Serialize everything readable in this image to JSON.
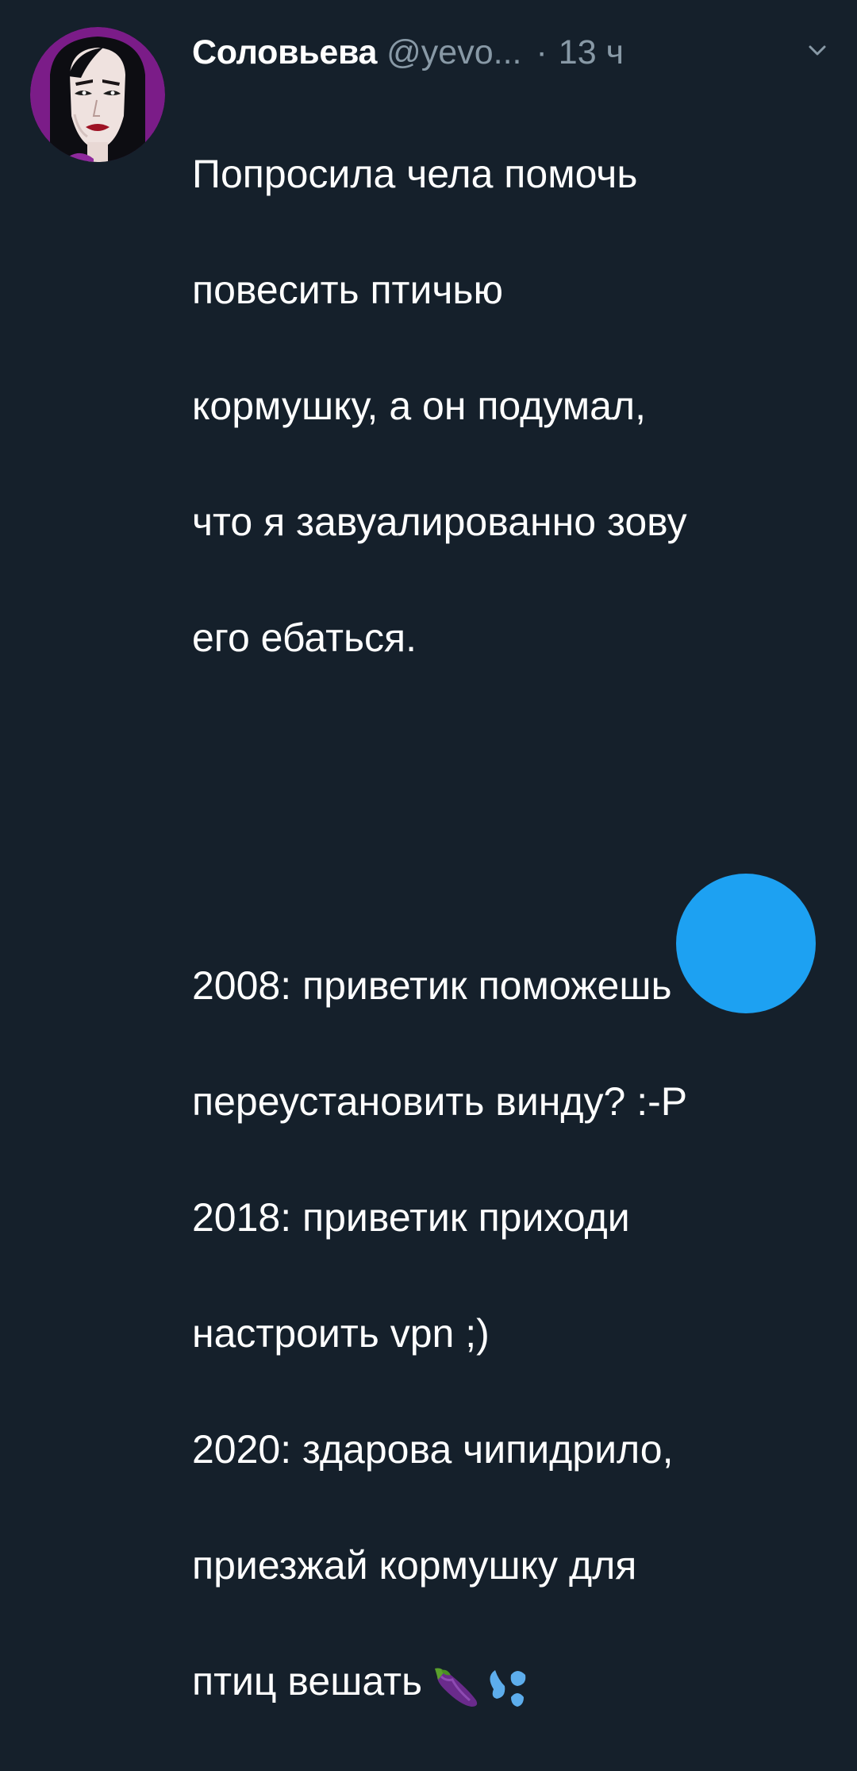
{
  "tweet": {
    "author_name": "Соловьева",
    "handle": "@yevo...",
    "separator": "·",
    "time": "13 ч",
    "body_lines": [
      "Попросила чела помочь",
      "повесить птичью",
      "кормушку, а он подумал,",
      "что я завуалированно зову",
      "его ебаться.",
      "",
      "2008: приветик поможешь",
      "переустановить винду? :-P",
      "2018: приветик приходи",
      "настроить vpn ;)",
      "2020: здарова чипидрило,",
      "приезжай кормушку для",
      "птиц вешать"
    ],
    "emojis": [
      "eggplant-icon",
      "sweat-droplets-icon"
    ]
  },
  "colors": {
    "background": "#15202b",
    "text": "#ffffff",
    "secondary_text": "#8899a6",
    "accent": "#1da1f2",
    "avatar_ring": "#7a1a86"
  },
  "icons": {
    "menu": "chevron-down-icon",
    "compose": "compose-fab"
  }
}
